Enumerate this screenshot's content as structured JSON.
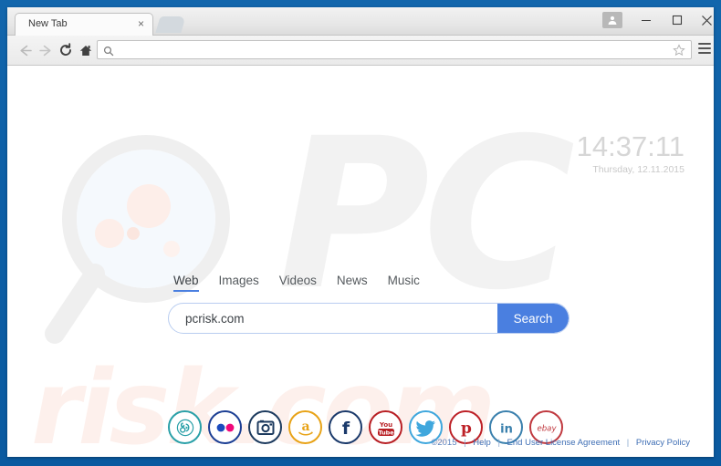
{
  "browser": {
    "tab_title": "New Tab",
    "tab_close_label": "×",
    "new_tab_label": "",
    "profile_icon": "person-icon",
    "minimize_label": "—",
    "maximize_label": "□",
    "close_label": "✕",
    "nav": {
      "back": "back-arrow-icon",
      "forward": "forward-arrow-icon",
      "reload": "reload-icon",
      "home": "home-icon"
    },
    "omnibox": {
      "value": "",
      "placeholder": "",
      "search_icon": "search-icon",
      "bookmark_icon": "star-icon"
    },
    "menu_icon": "hamburger-menu-icon"
  },
  "page": {
    "watermark_pc": "PC",
    "watermark_risk": "risk.com",
    "clock": {
      "time": "14:37:11",
      "date": "Thursday, 12.11.2015"
    },
    "search": {
      "tabs": [
        {
          "label": "Web",
          "active": true
        },
        {
          "label": "Images",
          "active": false
        },
        {
          "label": "Videos",
          "active": false
        },
        {
          "label": "News",
          "active": false
        },
        {
          "label": "Music",
          "active": false
        }
      ],
      "query": "pcrisk.com",
      "placeholder": "Search",
      "button_label": "Search",
      "accent_color": "#4a7fe0"
    },
    "social_icons": [
      {
        "name": "music-play-icon",
        "title": "Music",
        "color": "#2aa0a8"
      },
      {
        "name": "flickr-icon",
        "title": "Flickr",
        "color": "#1c3f94"
      },
      {
        "name": "instagram-icon",
        "title": "Instagram",
        "color": "#1c3a5e"
      },
      {
        "name": "amazon-icon",
        "title": "Amazon",
        "color": "#e8a317"
      },
      {
        "name": "facebook-icon",
        "title": "Facebook",
        "color": "#1b3a6b"
      },
      {
        "name": "youtube-icon",
        "title": "YouTube",
        "color": "#b81f24"
      },
      {
        "name": "twitter-icon",
        "title": "Twitter",
        "color": "#3fa7dd"
      },
      {
        "name": "pinterest-icon",
        "title": "Pinterest",
        "color": "#bd2127"
      },
      {
        "name": "linkedin-icon",
        "title": "LinkedIn",
        "color": "#3a80ad"
      },
      {
        "name": "ebay-icon",
        "title": "eBay",
        "color": "#c0393f"
      }
    ],
    "footer": {
      "copyright": "©2015",
      "sep": "|",
      "help": "Help",
      "eula": "End User License Agreement",
      "privacy": "Privacy Policy"
    }
  },
  "colors": {
    "window_frame": "#0d5fa6",
    "accent": "#4a7fe0",
    "footer_link": "#3f6fb5"
  }
}
